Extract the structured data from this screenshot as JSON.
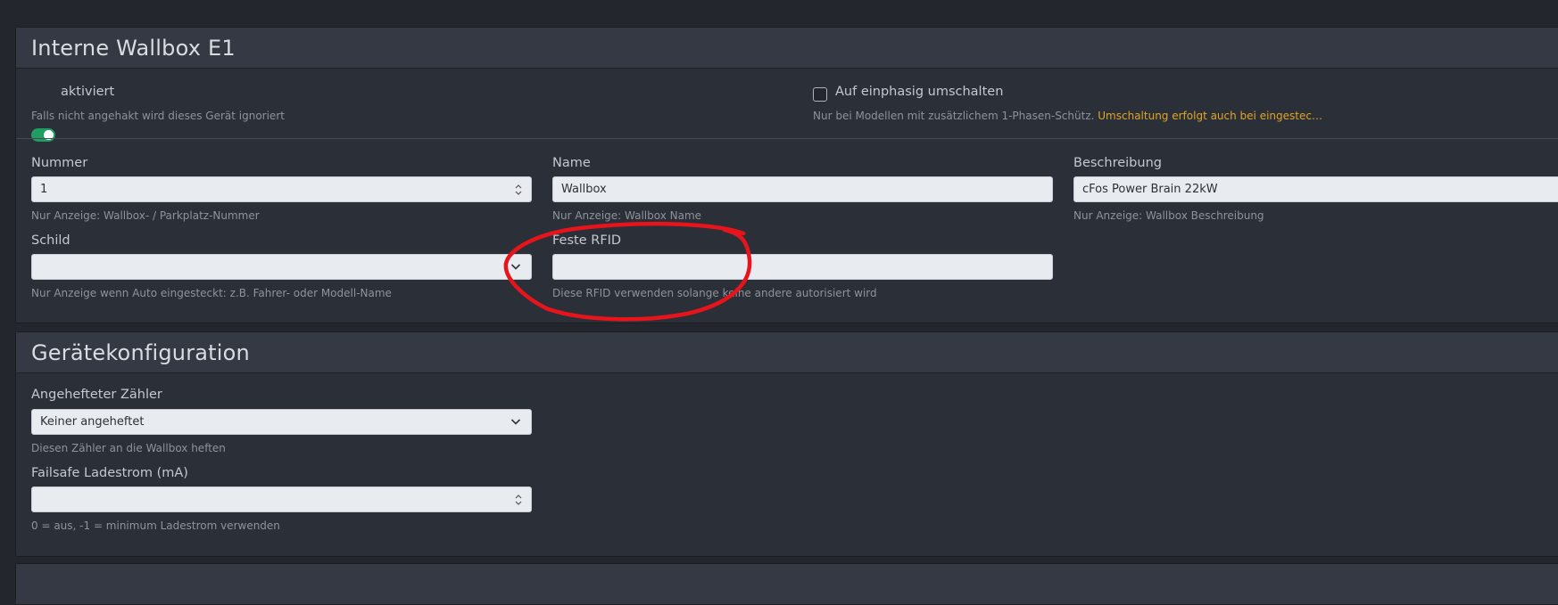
{
  "wallbox": {
    "title": "Interne Wallbox E1",
    "enabled_label": "aktiviert",
    "enabled_hint": "Falls nicht angehakt wird dieses Gerät ignoriert",
    "phase_label": "Auf einphasig umschalten",
    "phase_hint": "Nur bei Modellen mit zusätzlichem 1-Phasen-Schütz.",
    "phase_hint_warn": "Umschaltung erfolgt auch bei eingestec…",
    "number": {
      "label": "Nummer",
      "value": "1",
      "hint": "Nur Anzeige: Wallbox- / Parkplatz-Nummer"
    },
    "name": {
      "label": "Name",
      "value": "Wallbox",
      "hint": "Nur Anzeige: Wallbox Name"
    },
    "description": {
      "label": "Beschreibung",
      "value": "cFos Power Brain 22kW",
      "hint": "Nur Anzeige: Wallbox Beschreibung"
    },
    "sign": {
      "label": "Schild",
      "value": "",
      "hint": "Nur Anzeige wenn Auto eingesteckt: z.B. Fahrer- oder Modell-Name"
    },
    "rfid": {
      "label": "Feste RFID",
      "value": "",
      "hint": "Diese RFID verwenden solange keine andere autorisiert wird"
    }
  },
  "config": {
    "title": "Gerätekonfiguration",
    "meter": {
      "label": "Angehefteter Zähler",
      "value": "Keiner angeheftet",
      "hint": "Diesen Zähler an die Wallbox heften"
    },
    "failsafe": {
      "label": "Failsafe Ladestrom (mA)",
      "value": "",
      "hint": "0 = aus, -1 = minimum Ladestrom verwenden"
    }
  },
  "annotation": {
    "color": "#e8141b"
  }
}
